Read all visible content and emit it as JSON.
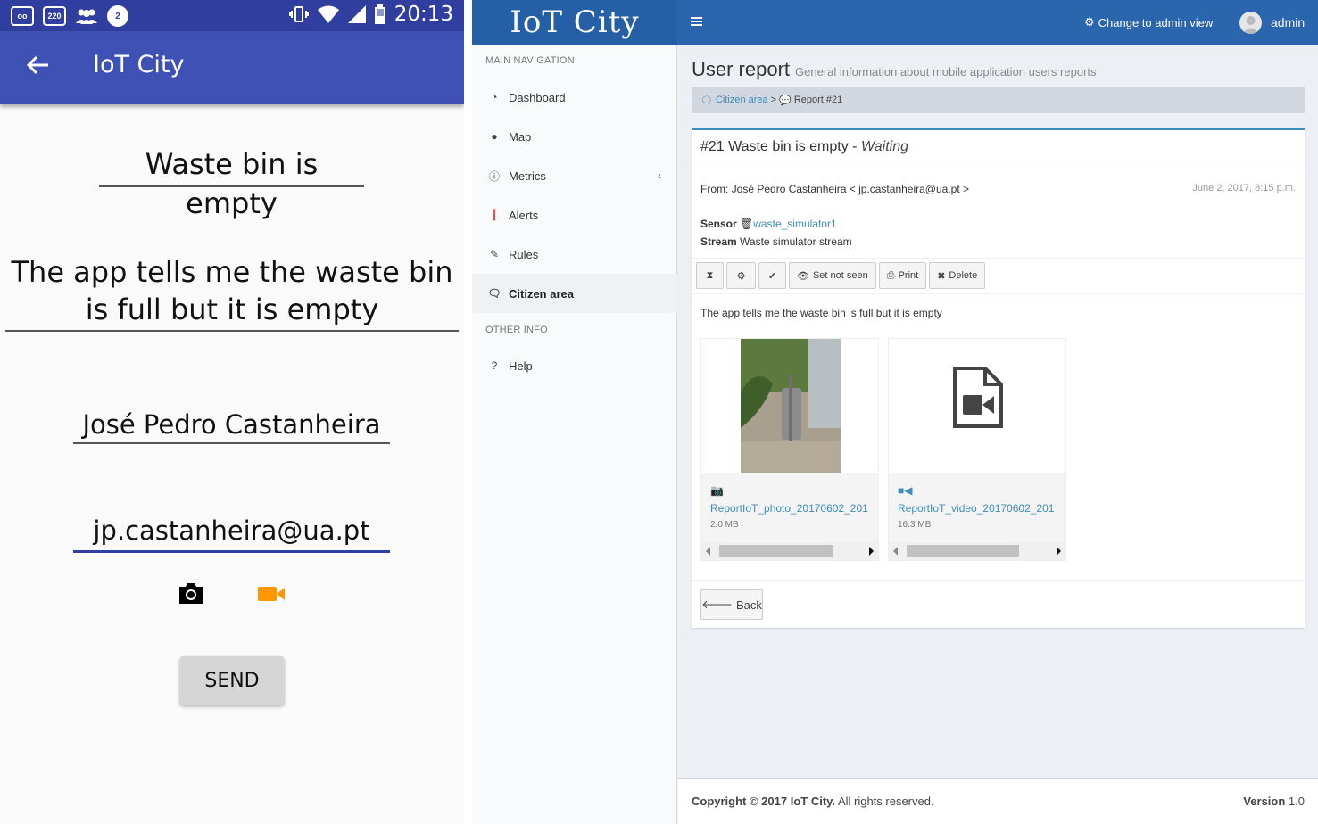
{
  "android": {
    "status_time": "20:13",
    "status_icons": [
      "voicemail-icon",
      "counter-220-icon",
      "group-icon",
      "notification-2-icon"
    ],
    "status_badge_220": "220",
    "status_badge_2": "2",
    "app_title": "IoT City",
    "title_field": "Waste bin is empty",
    "desc_field": "The app tells me the waste bin is full but it is empty",
    "name_field": "José Pedro Castanheira",
    "email_field": "jp.castanheira@ua.pt",
    "send_label": "SEND",
    "colors": {
      "status": "#303f9f",
      "appbar": "#3f51b5",
      "video": "#ff9800"
    }
  },
  "admin": {
    "logo": "IoT City",
    "admin_view_label": "Change to admin view",
    "user": "admin",
    "nav_head_main": "MAIN NAVIGATION",
    "nav_head_other": "OTHER INFO",
    "nav": [
      {
        "label": "Dashboard",
        "icon": "dashboard-icon"
      },
      {
        "label": "Map",
        "icon": "map-marker-icon"
      },
      {
        "label": "Metrics",
        "icon": "info-icon"
      },
      {
        "label": "Alerts",
        "icon": "alert-icon"
      },
      {
        "label": "Rules",
        "icon": "pencil-icon"
      },
      {
        "label": "Citizen area",
        "icon": "comments-icon"
      },
      {
        "label": "Help",
        "icon": "help-icon"
      }
    ],
    "page_title": "User report",
    "page_subtitle": "General information about mobile application users reports",
    "breadcrumb": {
      "root": "Citizen area",
      "sep": ">",
      "current": "Report #21"
    },
    "report": {
      "title": "#21 Waste bin is empty -",
      "status": "Waiting",
      "from": "From: José Pedro Castanheira < jp.castanheira@ua.pt >",
      "date": "June 2, 2017, 8:15 p.m.",
      "sensor_label": "Sensor",
      "sensor_value": "waste_simulator1",
      "stream_label": "Stream",
      "stream_value": "Waste simulator stream",
      "message": "The app tells me the waste bin is full but it is empty"
    },
    "buttons": {
      "set_not_seen": "Set not seen",
      "print": "Print",
      "delete": "Delete",
      "back": "Back"
    },
    "attachments": [
      {
        "name": "ReportIoT_photo_20170602_201",
        "size": "2.0 MB",
        "icon": "camera-icon"
      },
      {
        "name": "ReportIoT_video_20170602_201",
        "size": "16.3 MB",
        "icon": "video-icon"
      }
    ],
    "footer": {
      "copyright_bold": "Copyright © 2017 IoT City.",
      "copyright_rest": "All rights reserved.",
      "version_bold": "Version",
      "version": "1.0"
    },
    "colors": {
      "topbar": "#2b65ae",
      "accent": "#3c8dbc"
    }
  }
}
